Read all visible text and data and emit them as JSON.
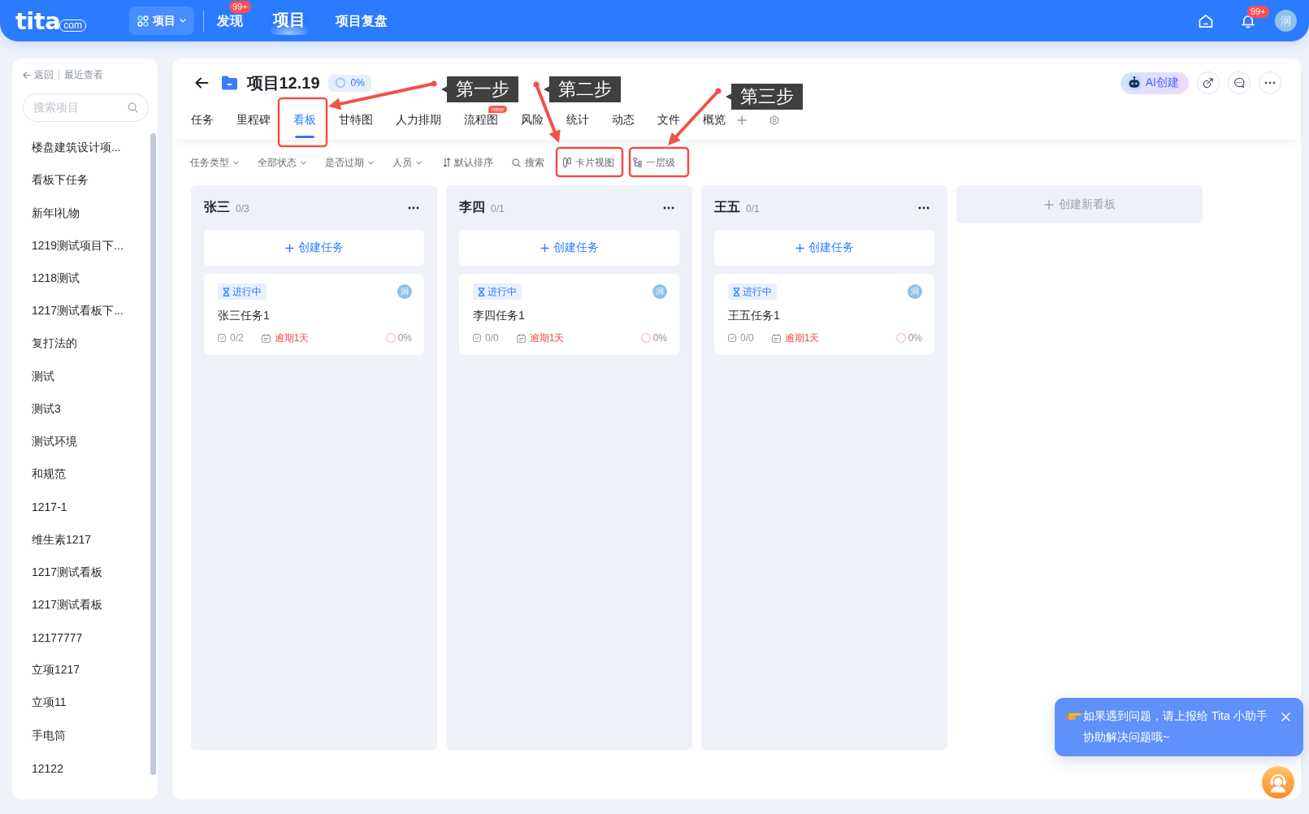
{
  "top_bar": {
    "logo": {
      "wordmark": "tita",
      "suffix": "com"
    },
    "app_switcher": {
      "label": "项目"
    },
    "nav": [
      {
        "label": "发现",
        "badge": "99+",
        "selected": false
      },
      {
        "label": "项目",
        "selected": true
      },
      {
        "label": "项目复盘",
        "selected": false
      }
    ],
    "notifications": {
      "badge": "99+"
    },
    "avatar": "润"
  },
  "sidebar": {
    "back": "返回",
    "recent": "最近查看",
    "search": {
      "placeholder": "搜索项目"
    },
    "items": [
      {
        "label": "楼盘建筑设计项...",
        "selected": false
      },
      {
        "label": "看板下任务",
        "selected": false
      },
      {
        "label": "新年l礼物",
        "selected": false
      },
      {
        "label": "1219测试项目下...",
        "selected": false
      },
      {
        "label": "1218测试",
        "selected": false
      },
      {
        "label": "1217测试看板下...",
        "selected": false
      },
      {
        "label": "复打法的",
        "selected": false
      },
      {
        "label": "测试",
        "selected": false
      },
      {
        "label": "测试3",
        "selected": false
      },
      {
        "label": "测试环境",
        "selected": false
      },
      {
        "label": "和规范",
        "selected": false
      },
      {
        "label": "1217-1",
        "selected": false
      },
      {
        "label": "维生素1217",
        "selected": false
      },
      {
        "label": "1217测试看板",
        "selected": false
      },
      {
        "label": "1217测试看板",
        "selected": false
      },
      {
        "label": "12177777",
        "selected": false
      },
      {
        "label": "立项1217",
        "selected": false
      },
      {
        "label": "立项11",
        "selected": false
      },
      {
        "label": "手电筒",
        "selected": false
      },
      {
        "label": "12122",
        "selected": false
      }
    ]
  },
  "project": {
    "title": "项目12.19",
    "progress": "0%",
    "ai_button": "AI创建"
  },
  "tabs": [
    {
      "label": "任务",
      "selected": false
    },
    {
      "label": "里程碑",
      "selected": false
    },
    {
      "label": "看板",
      "selected": true
    },
    {
      "label": "甘特图",
      "selected": false
    },
    {
      "label": "人力排期",
      "selected": false
    },
    {
      "label": "流程图",
      "badge": "new",
      "selected": false
    },
    {
      "label": "风险",
      "selected": false
    },
    {
      "label": "统计",
      "selected": false
    },
    {
      "label": "动态",
      "selected": false
    },
    {
      "label": "文件",
      "selected": false
    },
    {
      "label": "概览",
      "selected": false
    }
  ],
  "filters": [
    {
      "kind": "dropdown",
      "label": "任务类型"
    },
    {
      "kind": "dropdown",
      "label": "全部状态"
    },
    {
      "kind": "dropdown",
      "label": "是否过期"
    },
    {
      "kind": "dropdown",
      "label": "人员"
    },
    {
      "kind": "sort",
      "label": "默认排序"
    },
    {
      "kind": "search",
      "label": "搜索"
    },
    {
      "kind": "view",
      "label": "卡片视图"
    },
    {
      "kind": "level",
      "label": "一层级"
    }
  ],
  "board": {
    "columns": [
      {
        "name": "张三",
        "count": "0/3",
        "create_label": "创建任务",
        "cards": [
          {
            "status": "进行中",
            "assignee": "润",
            "title": "张三任务1",
            "subtasks": "0/2",
            "due": "逾期1天",
            "overdue": true,
            "progress": "0%"
          }
        ]
      },
      {
        "name": "李四",
        "count": "0/1",
        "create_label": "创建任务",
        "cards": [
          {
            "status": "进行中",
            "assignee": "润",
            "title": "李四任务1",
            "subtasks": "0/0",
            "due": "逾期1天",
            "overdue": true,
            "progress": "0%"
          }
        ]
      },
      {
        "name": "王五",
        "count": "0/1",
        "create_label": "创建任务",
        "cards": [
          {
            "status": "进行中",
            "assignee": "润",
            "title": "王五任务1",
            "subtasks": "0/0",
            "due": "逾期1天",
            "overdue": true,
            "progress": "0%"
          }
        ]
      }
    ],
    "new_board_label": "创建新看板"
  },
  "help_popup": {
    "text": "如果遇到问题，请上报给 Tita 小助手协助解决问题哦~"
  },
  "annotations": [
    {
      "label": "第一步"
    },
    {
      "label": "第二步"
    },
    {
      "label": "第三步"
    }
  ]
}
